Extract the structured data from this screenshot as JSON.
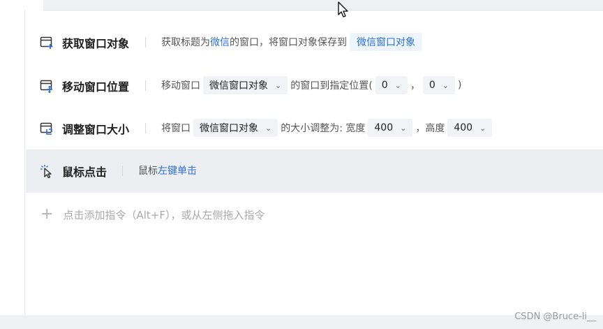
{
  "steps": [
    {
      "title": "获取窗口对象",
      "icon": "window-add-icon",
      "desc": {
        "prefix": "获取标题为",
        "title_value": "微信",
        "middle": "的窗口，将窗口对象保存到",
        "var_chip": "微信窗口对象"
      }
    },
    {
      "title": "移动窗口位置",
      "icon": "window-move-icon",
      "desc": {
        "prefix": "移动窗口",
        "window_select": "微信窗口对象",
        "middle": "的窗口到指定位置(",
        "x_value": "0",
        "comma": "，",
        "y_value": "0",
        "suffix": ")"
      }
    },
    {
      "title": "调整窗口大小",
      "icon": "window-resize-icon",
      "desc": {
        "prefix": "将窗口",
        "window_select": "微信窗口对象",
        "middle": "的大小调整为: 宽度",
        "width_value": "400",
        "comma": "，高度",
        "height_value": "400"
      }
    },
    {
      "title": "鼠标点击",
      "icon": "mouse-click-icon",
      "desc": {
        "prefix": "鼠标",
        "action": "左键单击"
      }
    }
  ],
  "add_instruction": "点击添加指令（Alt+F），或从左侧拖入指令",
  "watermark": "CSDN @Bruce-li__",
  "colors": {
    "accent": "#2b6fd6",
    "chip_bg": "#eef5fd",
    "selected_row": "#eceef1"
  }
}
